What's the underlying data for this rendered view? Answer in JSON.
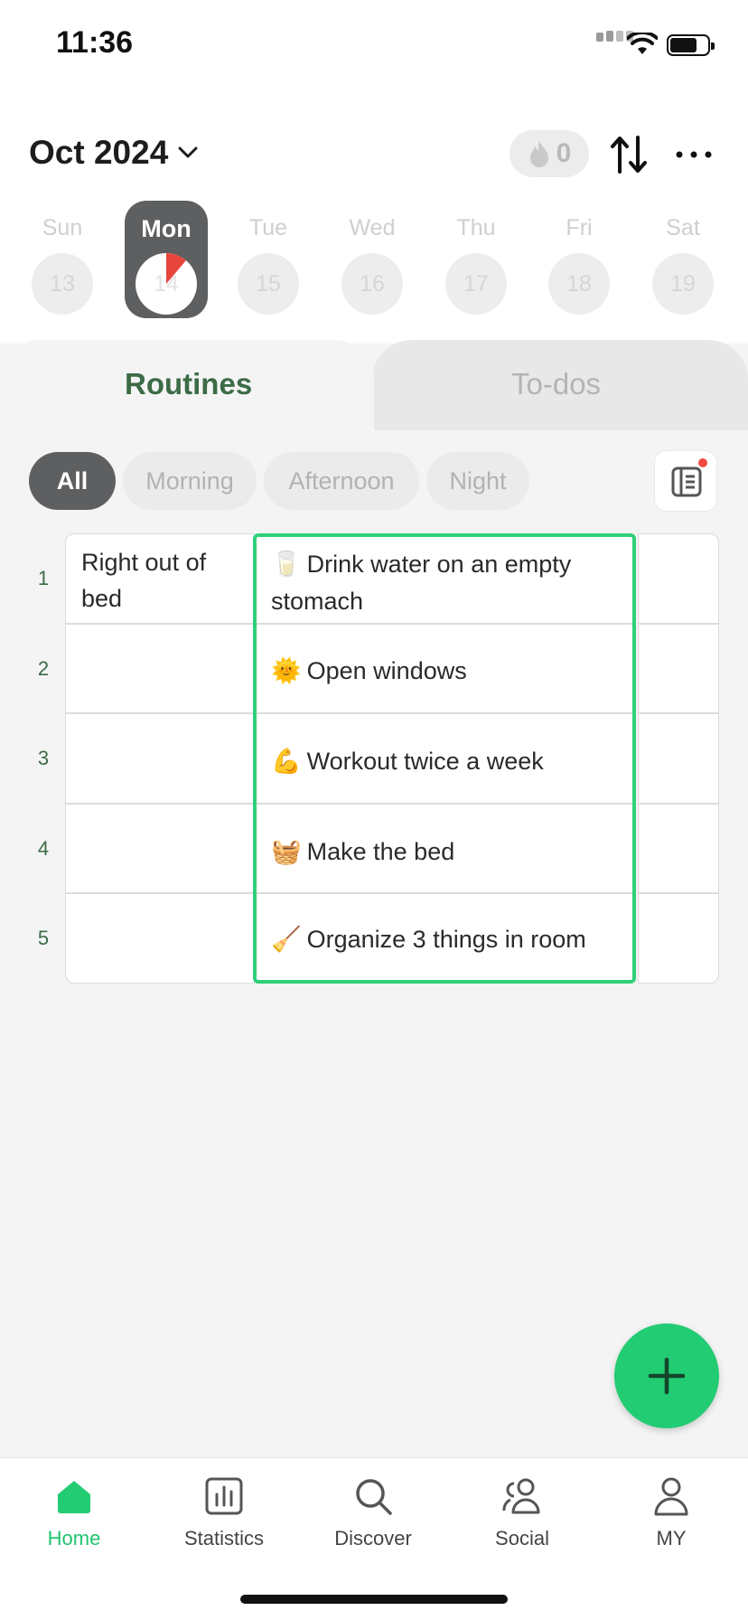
{
  "status_bar": {
    "time": "11:36"
  },
  "header": {
    "month": "Oct 2024",
    "streak_count": "0"
  },
  "week": [
    {
      "name": "Sun",
      "num": "13"
    },
    {
      "name": "Mon",
      "num": "14"
    },
    {
      "name": "Tue",
      "num": "15"
    },
    {
      "name": "Wed",
      "num": "16"
    },
    {
      "name": "Thu",
      "num": "17"
    },
    {
      "name": "Fri",
      "num": "18"
    },
    {
      "name": "Sat",
      "num": "19"
    }
  ],
  "tabs": {
    "routines": "Routines",
    "todos": "To-dos"
  },
  "filters": [
    "All",
    "Morning",
    "Afternoon",
    "Night"
  ],
  "grid": {
    "row_numbers": [
      "1",
      "2",
      "3",
      "4",
      "5"
    ],
    "left_column": {
      "row1": "Right out of bed"
    },
    "routines": [
      {
        "emoji": "🥛",
        "text": "Drink water on an empty stomach"
      },
      {
        "emoji": "🌞",
        "text": "Open windows"
      },
      {
        "emoji": "💪",
        "text": "Workout twice a week"
      },
      {
        "emoji": "🧺",
        "text": "Make the bed"
      },
      {
        "emoji": "🧹",
        "text": "Organize 3 things in room"
      }
    ]
  },
  "nav": [
    "Home",
    "Statistics",
    "Discover",
    "Social",
    "MY"
  ],
  "colors": {
    "accent": "#22cc73",
    "routine_green": "#3c6b46",
    "progress_red": "#e8453c"
  }
}
